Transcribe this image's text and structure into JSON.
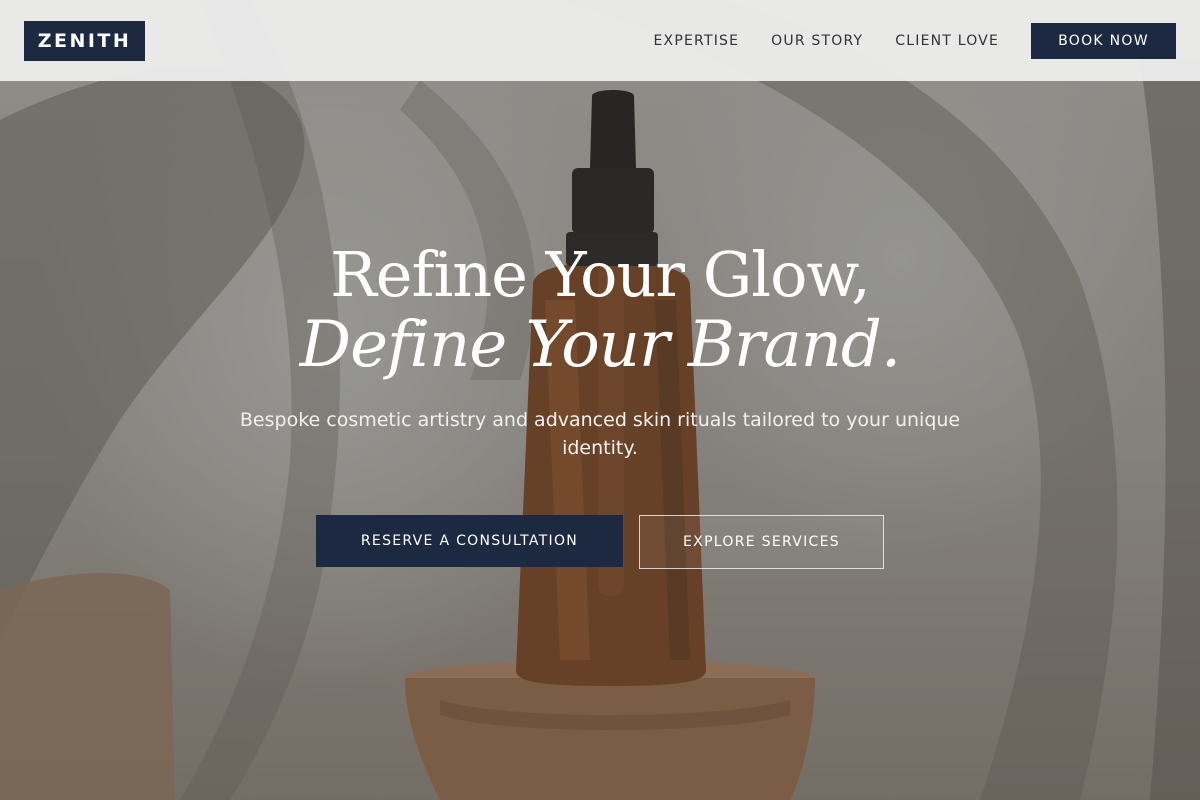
{
  "header": {
    "logo_text": "ZENITH",
    "nav": [
      {
        "label": "EXPERTISE"
      },
      {
        "label": "OUR STORY"
      },
      {
        "label": "CLIENT LOVE"
      }
    ],
    "book_label": "BOOK NOW"
  },
  "hero": {
    "headline_line1": "Refine Your Glow,",
    "headline_line2": "Define Your Brand.",
    "subheading": "Bespoke cosmetic artistry and advanced skin rituals tailored to your unique identity.",
    "primary_cta": "RESERVE A CONSULTATION",
    "secondary_cta": "EXPLORE SERVICES"
  },
  "colors": {
    "brand_navy": "#1c2940",
    "header_bg": "#ececec",
    "text_white": "#ffffff"
  }
}
